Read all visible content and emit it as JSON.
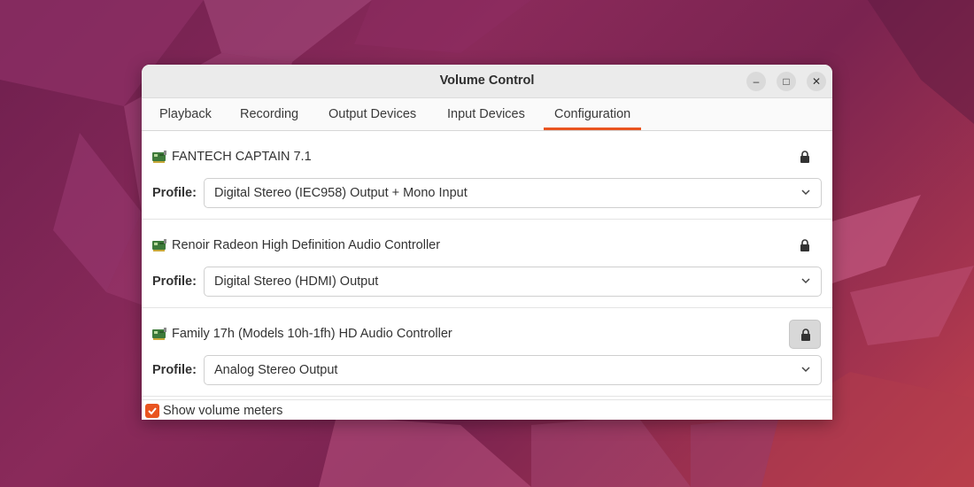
{
  "window": {
    "title": "Volume Control",
    "minimize_glyph": "–",
    "maximize_glyph": "□",
    "close_glyph": "✕"
  },
  "tabs": [
    {
      "label": "Playback",
      "active": false
    },
    {
      "label": "Recording",
      "active": false
    },
    {
      "label": "Output Devices",
      "active": false
    },
    {
      "label": "Input Devices",
      "active": false
    },
    {
      "label": "Configuration",
      "active": true
    }
  ],
  "cards": [
    {
      "name": "FANTECH CAPTAIN 7.1",
      "profile_label": "Profile:",
      "profile_value": "Digital Stereo (IEC958) Output + Mono Input",
      "lock_pressed": false,
      "icon": "sound-card-icon"
    },
    {
      "name": "Renoir Radeon High Definition Audio Controller",
      "profile_label": "Profile:",
      "profile_value": "Digital Stereo (HDMI) Output",
      "lock_pressed": false,
      "icon": "sound-card-icon"
    },
    {
      "name": "Family 17h (Models 10h-1fh) HD Audio Controller",
      "profile_label": "Profile:",
      "profile_value": "Analog Stereo Output",
      "lock_pressed": true,
      "icon": "sound-card-icon"
    }
  ],
  "footer": {
    "show_meters_label": "Show volume meters",
    "show_meters_checked": true
  },
  "colors": {
    "accent": "#e95420",
    "titlebar": "#ebebeb",
    "wallpaper": "#7a2350"
  }
}
